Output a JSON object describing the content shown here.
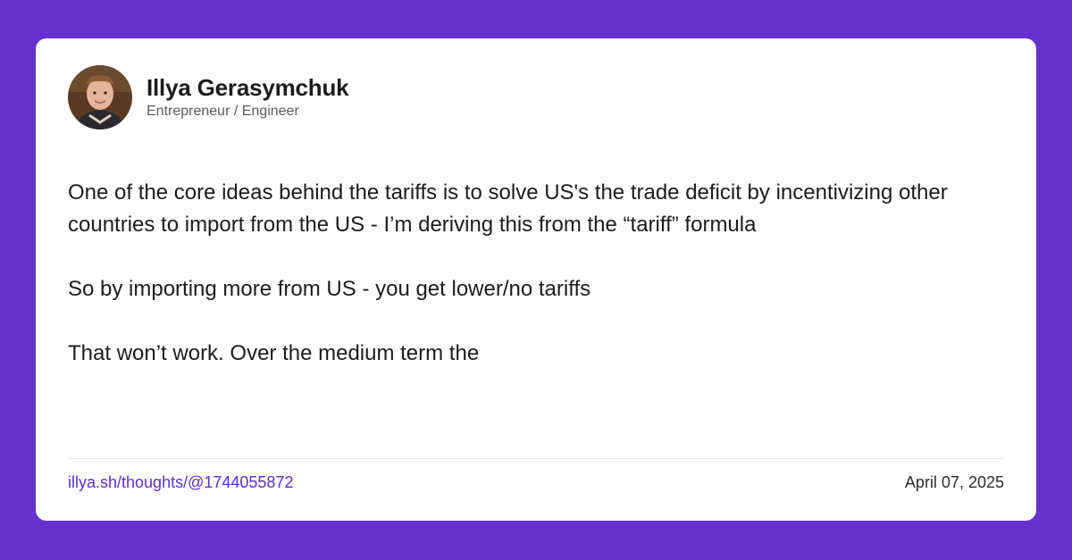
{
  "author": {
    "name": "Illya Gerasymchuk",
    "title": "Entrepreneur / Engineer"
  },
  "post": {
    "paragraphs": [
      "One of the core ideas behind the tariffs is to solve US's the trade deficit by incentivizing other countries to import from the US - I’m deriving this from the “tariff” formula",
      "So by importing more from US - you get lower/no tariffs",
      "That won’t work. Over the medium term the"
    ]
  },
  "footer": {
    "link": "illya.sh/thoughts/@1744055872",
    "date": "April 07, 2025"
  },
  "colors": {
    "background": "#6632cc",
    "card": "#ffffff",
    "link": "#5b2fc7"
  }
}
